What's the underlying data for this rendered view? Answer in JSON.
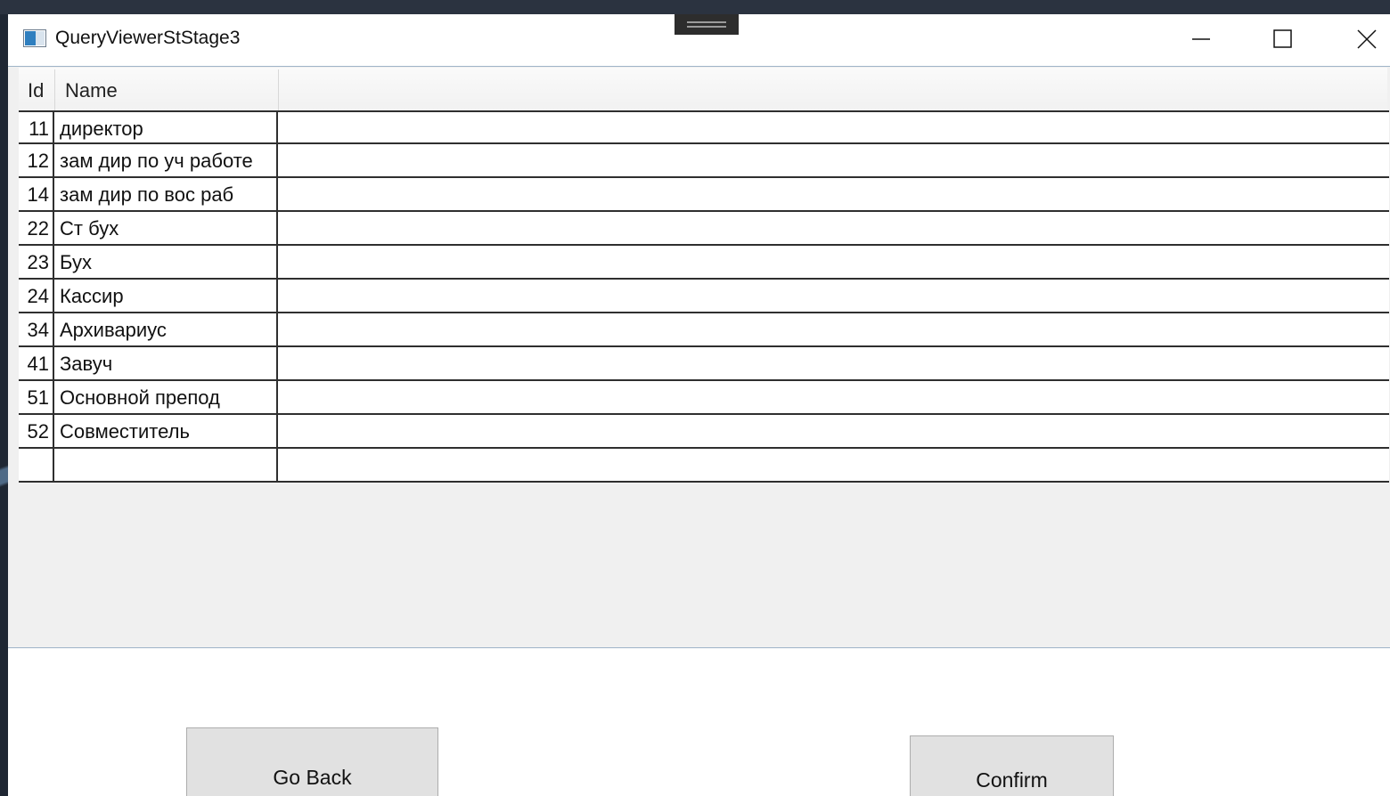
{
  "window": {
    "title": "QueryViewerStStage3"
  },
  "grid": {
    "columns": [
      "Id",
      "Name"
    ],
    "rows": [
      {
        "id": "11",
        "name": "директор"
      },
      {
        "id": "12",
        "name": "зам дир по уч работе"
      },
      {
        "id": "14",
        "name": "зам дир по вос  раб"
      },
      {
        "id": "22",
        "name": "Ст бух"
      },
      {
        "id": "23",
        "name": "Бух"
      },
      {
        "id": "24",
        "name": "Кассир"
      },
      {
        "id": "34",
        "name": "Архивариус"
      },
      {
        "id": "41",
        "name": "Завуч"
      },
      {
        "id": "51",
        "name": "Основной препод"
      },
      {
        "id": "52",
        "name": "Совместитель"
      },
      {
        "id": "",
        "name": ""
      }
    ]
  },
  "buttons": {
    "go_back": "Go Back",
    "confirm": "Confirm"
  },
  "icons": {
    "app": "app-window-icon",
    "minimize": "minimize-icon",
    "maximize": "maximize-icon",
    "close": "close-icon"
  }
}
